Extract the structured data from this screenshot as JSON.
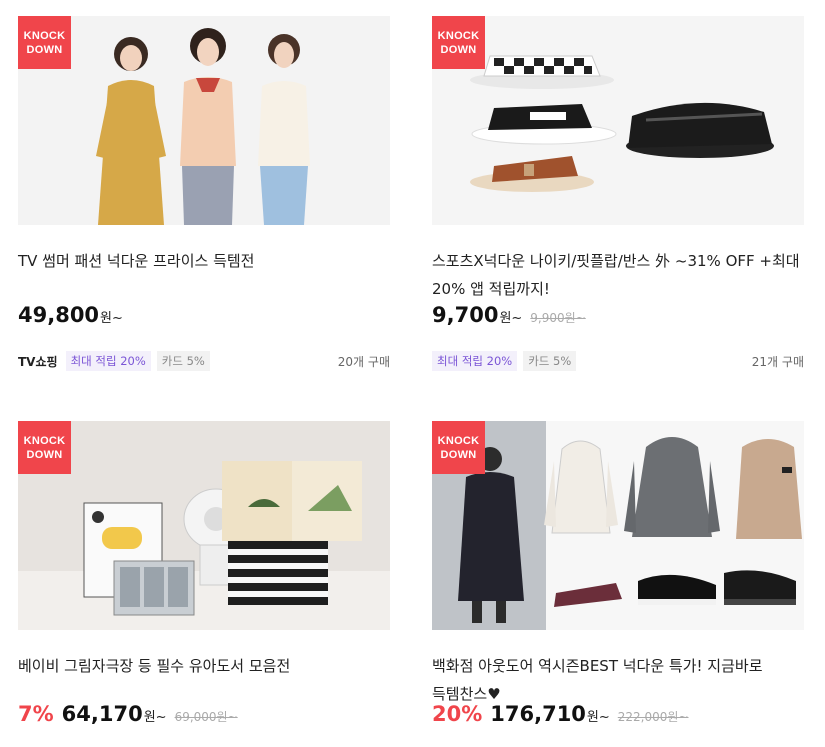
{
  "products": [
    {
      "badge_line1": "KNOCK",
      "badge_line2": "DOWN",
      "title": "TV 썸머 패션 넉다운 프라이스 득템전",
      "rate": "",
      "price": "49,800",
      "won": "원~",
      "original_price": "",
      "tv_label": "TV쇼핑",
      "tag_points": "최대 적립 20%",
      "tag_card": "카드 5%",
      "sold_count": "20개 구매"
    },
    {
      "badge_line1": "KNOCK",
      "badge_line2": "DOWN",
      "title": "스포츠X넉다운 나이키/핏플랍/반스 外 ~31% OFF +최대 20% 앱 적립까지!",
      "rate": "",
      "price": "9,700",
      "won": "원~",
      "original_price": "9,900원~",
      "tv_label": "",
      "tag_points": "최대 적립 20%",
      "tag_card": "카드 5%",
      "sold_count": "21개 구매"
    },
    {
      "badge_line1": "KNOCK",
      "badge_line2": "DOWN",
      "title": "베이비 그림자극장 등 필수 유아도서 모음전",
      "rate": "7%",
      "price": "64,170",
      "won": "원~",
      "original_price": "69,000원~"
    },
    {
      "badge_line1": "KNOCK",
      "badge_line2": "DOWN",
      "title": "백화점 아웃도어 역시즌BEST 넉다운 특가! 지금바로 득템찬스♥",
      "rate": "20%",
      "price": "176,710",
      "won": "원~",
      "original_price": "222,000원~"
    }
  ],
  "colors": {
    "badge": "#f0454b",
    "discount": "#f0454b",
    "points_tag_text": "#7b55d6",
    "points_tag_bg": "#f3f0fb"
  }
}
